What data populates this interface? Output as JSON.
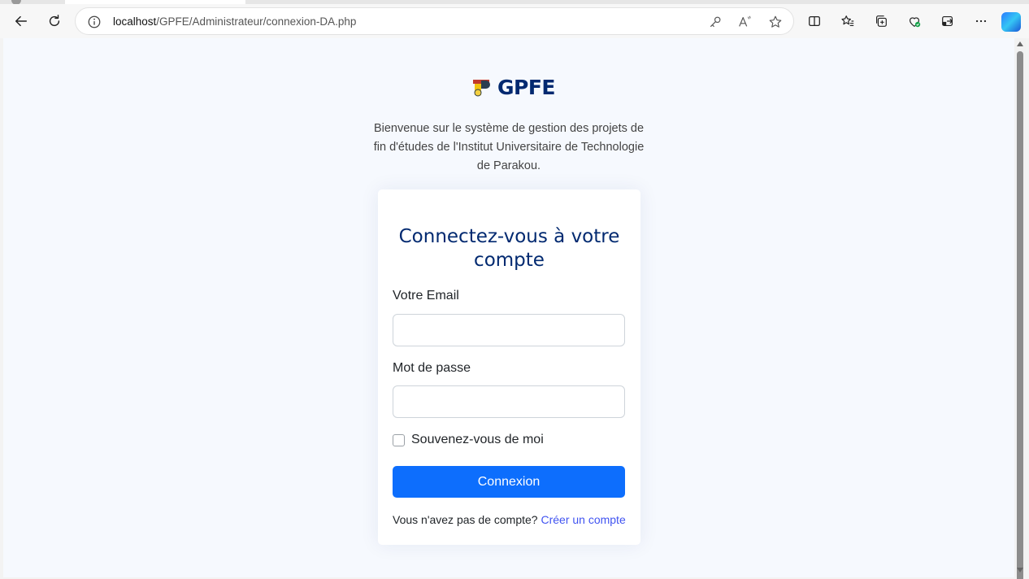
{
  "browser": {
    "url_host": "localhost",
    "url_path": "/GPFE/Administrateur/connexion-DA.php",
    "icons": [
      "back-icon",
      "refresh-icon",
      "info-icon",
      "key-icon",
      "read-aloud-icon",
      "favorite-star-icon",
      "split-screen-icon",
      "favorites-icon",
      "collections-icon",
      "browser-essentials-icon",
      "extensions-icon",
      "more-icon",
      "copilot-icon"
    ]
  },
  "brand": {
    "name": "GPFE"
  },
  "intro": {
    "text": "Bienvenue sur le système de gestion des projets de fin d'études de l'Institut Universitaire de Technologie de Parakou."
  },
  "login": {
    "title": "Connectez-vous à votre compte",
    "email_label": "Votre Email",
    "email_value": "",
    "password_label": "Mot de passe",
    "password_value": "",
    "remember_label": "Souvenez-vous de moi",
    "remember_checked": false,
    "submit_label": "Connexion",
    "no_account_text": "Vous n'avez pas de compte?",
    "create_account_link": "Créer un compte"
  },
  "colors": {
    "brand": "#012970",
    "primary": "#0d6efd",
    "link": "#4154f1",
    "page_bg": "#f6f9fe"
  }
}
